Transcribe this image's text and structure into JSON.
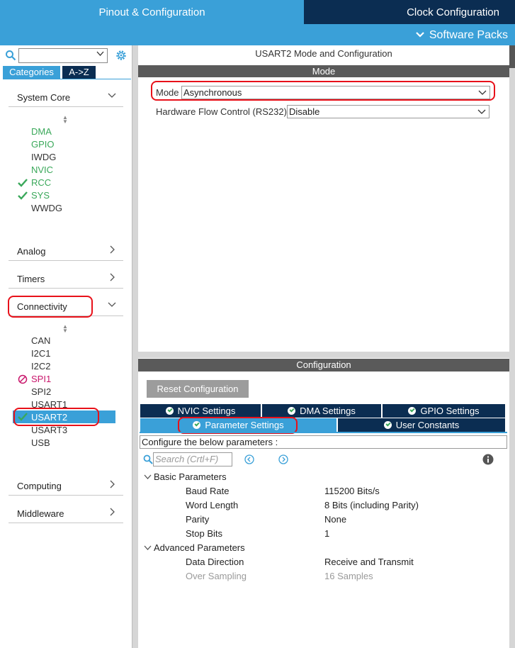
{
  "header": {
    "tab_pinout": "Pinout & Configuration",
    "tab_clock": "Clock Configuration",
    "tab_software": "Software Packs"
  },
  "sidebar": {
    "search_value": "",
    "tab_categories": "Categories",
    "tab_az": "A->Z",
    "system_core": {
      "label": "System Core",
      "items": [
        {
          "label": "DMA",
          "state": "green"
        },
        {
          "label": "GPIO",
          "state": "green"
        },
        {
          "label": "IWDG",
          "state": "normal"
        },
        {
          "label": "NVIC",
          "state": "green"
        },
        {
          "label": "RCC",
          "state": "check"
        },
        {
          "label": "SYS",
          "state": "check"
        },
        {
          "label": "WWDG",
          "state": "normal"
        }
      ]
    },
    "analog": "Analog",
    "timers": "Timers",
    "connectivity": {
      "label": "Connectivity",
      "items": [
        {
          "label": "CAN",
          "state": "normal"
        },
        {
          "label": "I2C1",
          "state": "normal"
        },
        {
          "label": "I2C2",
          "state": "normal"
        },
        {
          "label": "SPI1",
          "state": "disabled"
        },
        {
          "label": "SPI2",
          "state": "normal"
        },
        {
          "label": "USART1",
          "state": "normal"
        },
        {
          "label": "USART2",
          "state": "selected"
        },
        {
          "label": "USART3",
          "state": "normal"
        },
        {
          "label": "USB",
          "state": "normal"
        }
      ]
    },
    "computing": "Computing",
    "middleware": "Middleware"
  },
  "mode": {
    "title": "USART2 Mode and Configuration",
    "section": "Mode",
    "mode_label": "Mode",
    "mode_value": "Asynchronous",
    "hwflow_label": "Hardware Flow Control (RS232)",
    "hwflow_value": "Disable"
  },
  "configuration": {
    "section": "Configuration",
    "reset_button": "Reset Configuration",
    "tabs": {
      "nvic": "NVIC Settings",
      "dma": "DMA Settings",
      "gpio": "GPIO Settings",
      "parameter": "Parameter Settings",
      "user_constants": "User Constants"
    },
    "configure_text": "Configure the below parameters :",
    "search_placeholder": "Search (Crtl+F)",
    "basic_group": "Basic Parameters",
    "basic": [
      {
        "name": "Baud Rate",
        "value": "115200 Bits/s"
      },
      {
        "name": "Word Length",
        "value": "8 Bits (including Parity)"
      },
      {
        "name": "Parity",
        "value": "None"
      },
      {
        "name": "Stop Bits",
        "value": "1"
      }
    ],
    "advanced_group": "Advanced Parameters",
    "advanced": [
      {
        "name": "Data Direction",
        "value": "Receive and Transmit"
      },
      {
        "name": "Over Sampling",
        "value": "16 Samples"
      }
    ]
  },
  "colors": {
    "accent_blue": "#3aa0d8",
    "navy": "#0b2d52",
    "green": "#3aa85a",
    "disabled_pink": "#c8156b",
    "highlight_red": "#e8111a"
  }
}
